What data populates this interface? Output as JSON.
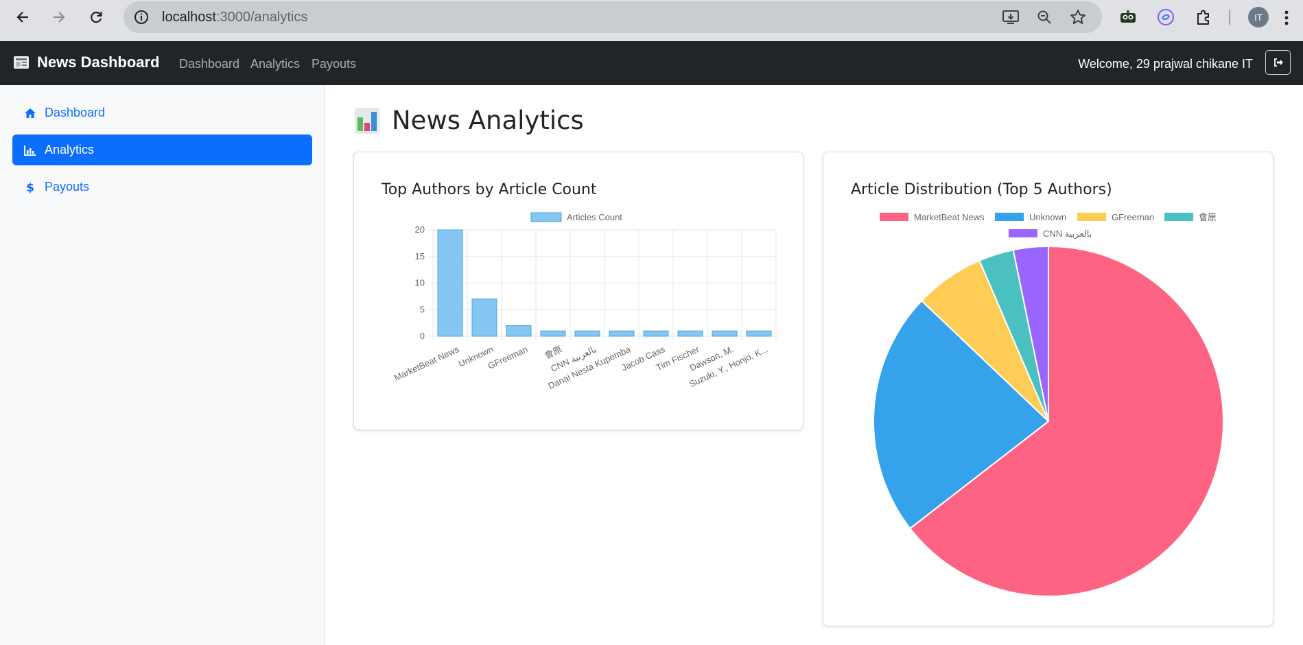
{
  "browser": {
    "url_host": "localhost",
    "url_path": ":3000/analytics",
    "profile_initials": "IT"
  },
  "navbar": {
    "brand": "News Dashboard",
    "links": [
      "Dashboard",
      "Analytics",
      "Payouts"
    ],
    "welcome": "Welcome, 29 prajwal chikane IT"
  },
  "sidebar": {
    "items": [
      {
        "label": "Dashboard",
        "icon": "home-icon",
        "active": false
      },
      {
        "label": "Analytics",
        "icon": "bar-chart-icon",
        "active": true
      },
      {
        "label": "Payouts",
        "icon": "dollar-icon",
        "active": false
      }
    ]
  },
  "main": {
    "title": "News Analytics"
  },
  "colors": {
    "accent": "#0d6efd",
    "navbar_bg": "#212529",
    "bar_fill": "#85c6f2",
    "bar_border": "#4aa3de"
  },
  "chart_data": [
    {
      "type": "bar",
      "title": "Top Authors by Article Count",
      "legend_position": "top",
      "grid": true,
      "categories": [
        "MarketBeat News",
        "Unknown",
        "GFreeman",
        "會原",
        "CNN بالعربية",
        "Danai Nesta Kupemba",
        "Jacob Cass",
        "Tim Fischer",
        "Dawson, M.",
        "Suzuki, Y., Honjo, K..."
      ],
      "series": [
        {
          "name": "Articles Count",
          "values": [
            20,
            7,
            2,
            1,
            1,
            1,
            1,
            1,
            1,
            1
          ]
        }
      ],
      "ylim": [
        0,
        20
      ],
      "yticks": [
        0,
        5,
        10,
        15,
        20
      ]
    },
    {
      "type": "pie",
      "title": "Article Distribution (Top 5 Authors)",
      "legend_position": "top",
      "labels": [
        "MarketBeat News",
        "Unknown",
        "GFreeman",
        "會原",
        "CNN بالعربية"
      ],
      "values": [
        20,
        7,
        2,
        1,
        1
      ],
      "colors": [
        "#ff6384",
        "#36a2eb",
        "#ffcd56",
        "#4bc0c0",
        "#9966ff"
      ]
    }
  ]
}
